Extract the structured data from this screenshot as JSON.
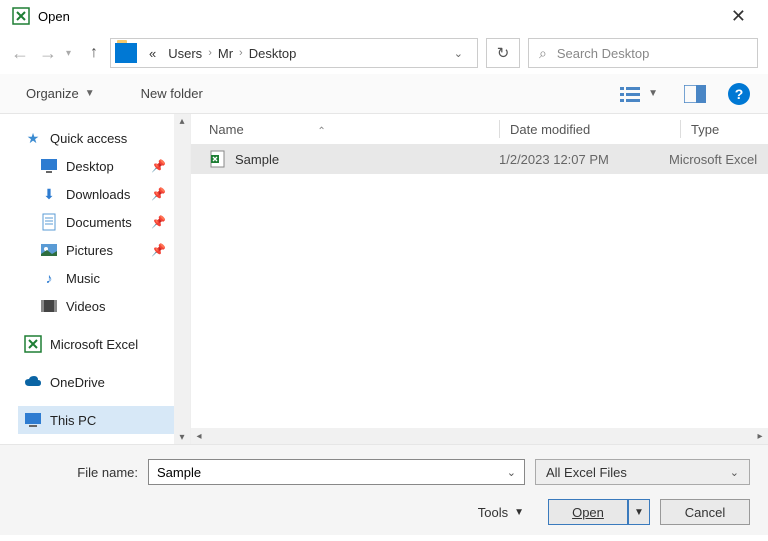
{
  "window": {
    "title": "Open"
  },
  "breadcrumb": {
    "prefix": "«",
    "items": [
      "Users",
      "Mr",
      "Desktop"
    ]
  },
  "search": {
    "placeholder": "Search Desktop"
  },
  "toolbar": {
    "organize": "Organize",
    "newfolder": "New folder"
  },
  "sidebar": {
    "quick": "Quick access",
    "desktop": "Desktop",
    "downloads": "Downloads",
    "documents": "Documents",
    "pictures": "Pictures",
    "music": "Music",
    "videos": "Videos",
    "excel": "Microsoft Excel",
    "onedrive": "OneDrive",
    "thispc": "This PC"
  },
  "columns": {
    "name": "Name",
    "date": "Date modified",
    "type": "Type"
  },
  "files": [
    {
      "name": "Sample",
      "date": "1/2/2023 12:07 PM",
      "type": "Microsoft Excel"
    }
  ],
  "bottom": {
    "filename_label": "File name:",
    "filename_value": "Sample",
    "filter": "All Excel Files",
    "tools": "Tools",
    "open": "Open",
    "cancel": "Cancel"
  }
}
